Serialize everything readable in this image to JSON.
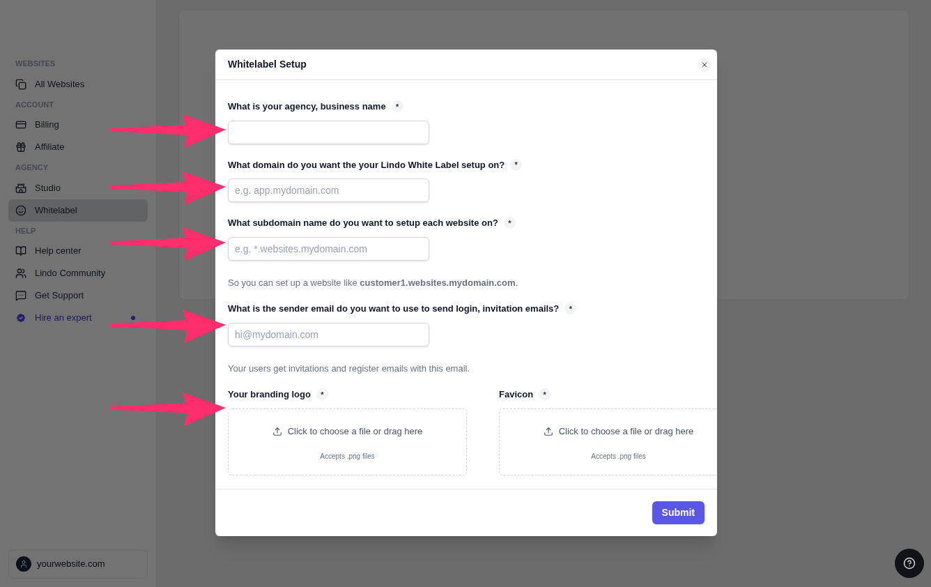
{
  "sidebar": {
    "sections": [
      {
        "heading": "WEBSITES",
        "items": [
          {
            "label": "All Websites",
            "selected": false
          }
        ]
      },
      {
        "heading": "ACCOUNT",
        "items": [
          {
            "label": "Billing",
            "selected": false
          },
          {
            "label": "Affiliate",
            "selected": false
          }
        ]
      },
      {
        "heading": "AGENCY",
        "items": [
          {
            "label": "Studio",
            "selected": false
          },
          {
            "label": "Whitelabel",
            "selected": true
          }
        ]
      },
      {
        "heading": "HELP",
        "items": [
          {
            "label": "Help center",
            "selected": false
          },
          {
            "label": "Lindo Community",
            "selected": false
          },
          {
            "label": "Get Support",
            "selected": false
          },
          {
            "label": "Hire an expert",
            "selected": false,
            "highlight": true
          }
        ]
      }
    ],
    "account": {
      "name": "yourwebsite.com"
    }
  },
  "modal": {
    "title": "Whitelabel Setup",
    "fields": [
      {
        "kind": "input",
        "label": "What is your agency, business name",
        "required_mark": "*"
      },
      {
        "kind": "input",
        "label": "What domain do you want the your Lindo White Label setup on?",
        "required_mark": "*",
        "placeholder": "e.g. app.mydomain.com"
      },
      {
        "kind": "input",
        "label": "What subdomain name do you want to setup each website on?",
        "required_mark": "*",
        "placeholder": "e.g. *.websites.mydomain.com",
        "help": "So you can set up a website like **customer1.websites.mydomain.com**."
      },
      {
        "kind": "input",
        "label": "What is the sender email do you want to use to send login, invitation emails?",
        "required_mark": "*",
        "placeholder": "hi@mydomain.com",
        "help": "Your users get invitations and register emails with this email."
      }
    ],
    "uploads": [
      {
        "label": "Your branding logo",
        "required_mark": "*",
        "prompt": "Click to choose a file or drag here",
        "note": "Accepts .png files"
      },
      {
        "label": "Favicon",
        "required_mark": "*",
        "prompt": "Click to choose a file or drag here",
        "note": "Accepts .png files"
      }
    ],
    "submit": "Submit"
  }
}
